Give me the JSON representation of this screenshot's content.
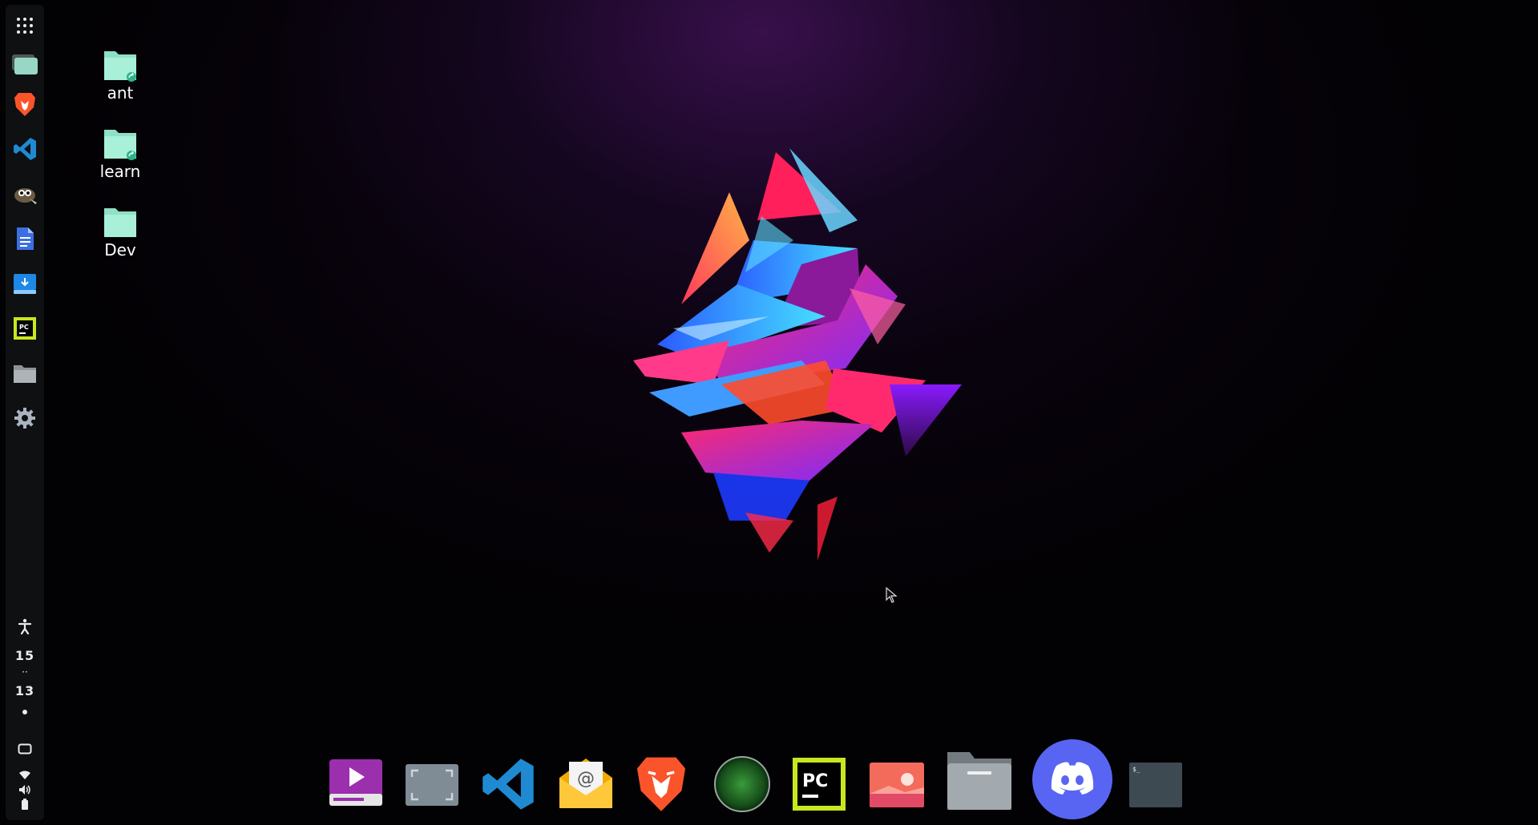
{
  "desktop": {
    "icons": [
      {
        "label": "ant",
        "shortcut": true
      },
      {
        "label": "learn",
        "shortcut": true
      },
      {
        "label": "Dev",
        "shortcut": false
      }
    ]
  },
  "side_panel": {
    "items": [
      {
        "name": "app-grid",
        "icon": "grid-icon"
      },
      {
        "name": "workspaces",
        "icon": "windows-icon"
      },
      {
        "name": "brave",
        "icon": "brave-lion-icon"
      },
      {
        "name": "vscode",
        "icon": "vscode-icon"
      },
      {
        "name": "gimp",
        "icon": "gimp-icon"
      },
      {
        "name": "text-editor",
        "icon": "document-icon"
      },
      {
        "name": "software-center",
        "icon": "store-icon"
      },
      {
        "name": "pycharm",
        "icon": "pycharm-icon"
      },
      {
        "name": "files",
        "icon": "folder-icon"
      },
      {
        "name": "settings",
        "icon": "gear-icon"
      }
    ],
    "status": {
      "accessibility_icon": "accessibility-icon",
      "clock_hour": "15",
      "clock_sep": "··",
      "clock_minute": "13",
      "overview_icon": "overview-icon",
      "wifi_icon": "wifi-icon",
      "volume_icon": "volume-icon",
      "battery_icon": "battery-icon"
    }
  },
  "dock": {
    "items": [
      {
        "name": "video-player",
        "icon": "video-player-icon"
      },
      {
        "name": "screenshot",
        "icon": "screenshot-icon"
      },
      {
        "name": "vscode",
        "icon": "vscode-icon"
      },
      {
        "name": "mail",
        "icon": "mail-icon"
      },
      {
        "name": "brave",
        "icon": "brave-lion-icon"
      },
      {
        "name": "radar",
        "icon": "globe-icon"
      },
      {
        "name": "pycharm",
        "icon": "pycharm-icon",
        "text": "PC"
      },
      {
        "name": "image-viewer",
        "icon": "image-icon"
      },
      {
        "name": "files",
        "icon": "folder-icon"
      },
      {
        "name": "discord",
        "icon": "discord-icon"
      },
      {
        "name": "terminal",
        "icon": "terminal-icon",
        "text": "$_"
      }
    ]
  },
  "colors": {
    "folder": "#a8f0d8",
    "folder_badge": "#2bb58a",
    "panel_bg": "#0e1012",
    "discord": "#5865f2",
    "pycharm_green": "#21d789"
  }
}
